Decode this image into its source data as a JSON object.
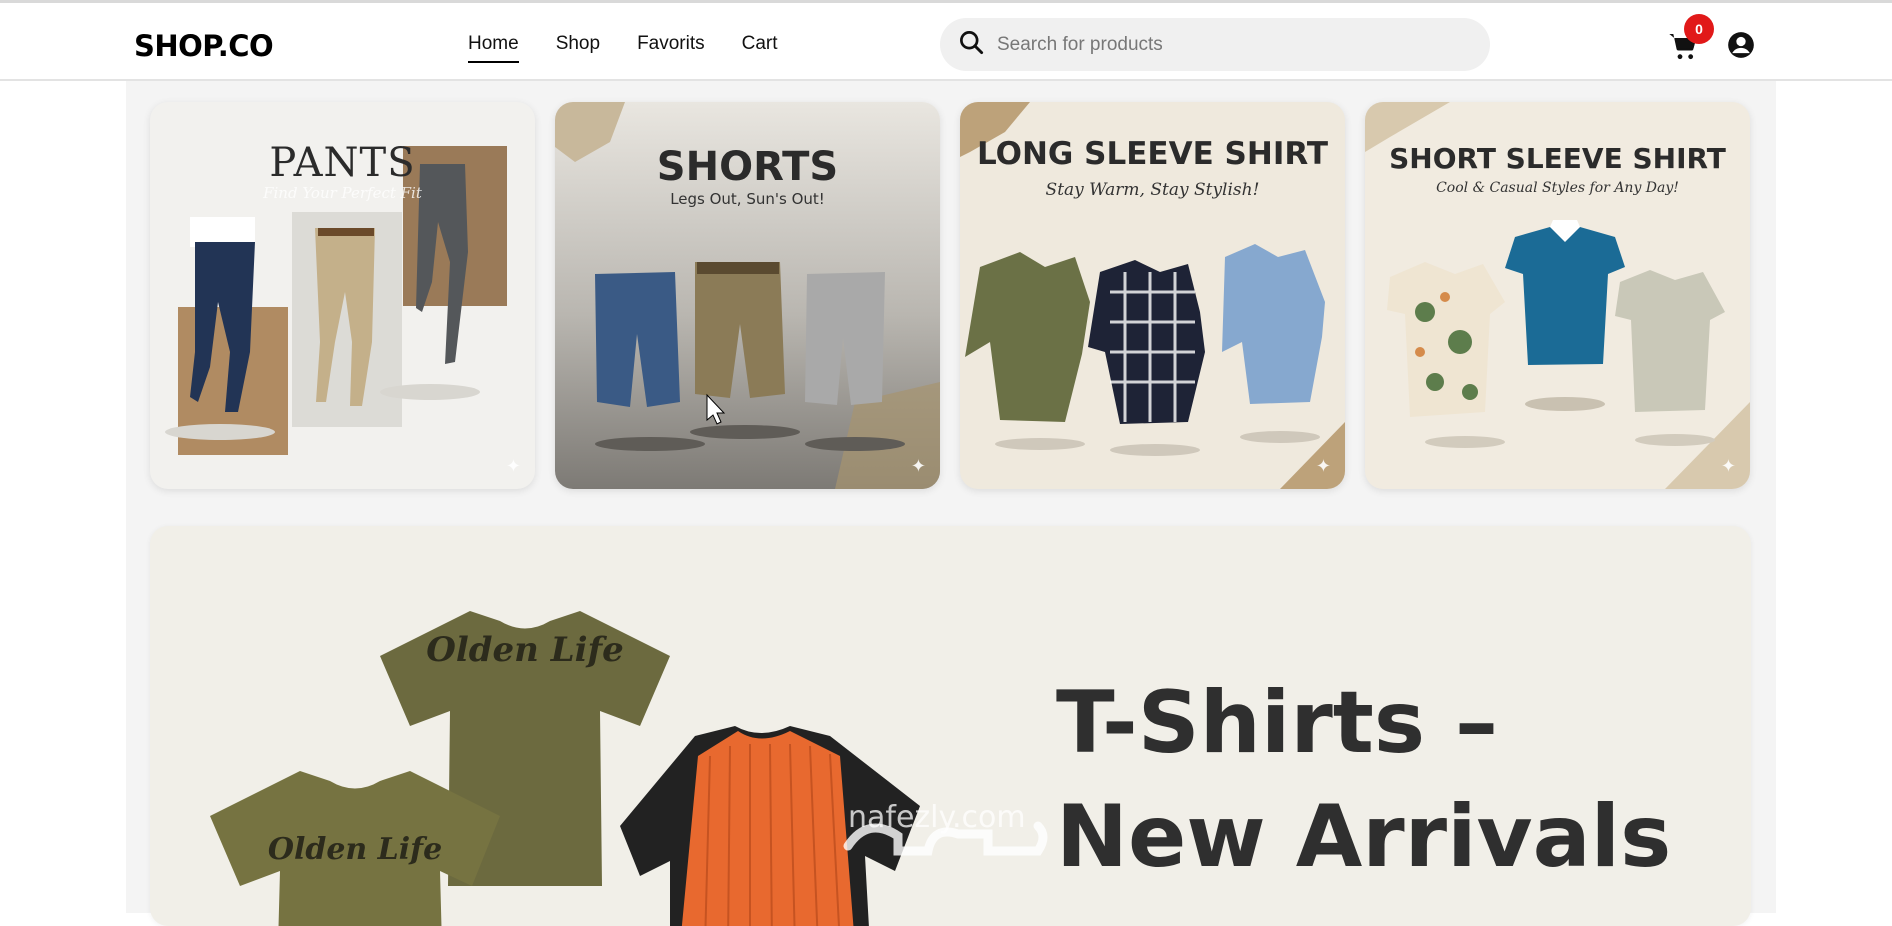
{
  "header": {
    "logo": "SHOP.CO",
    "nav": [
      {
        "label": "Home",
        "active": true
      },
      {
        "label": "Shop",
        "active": false
      },
      {
        "label": "Favorits",
        "active": false
      },
      {
        "label": "Cart",
        "active": false
      }
    ],
    "search": {
      "placeholder": "Search for products",
      "value": ""
    },
    "cart_count": "0",
    "icons": [
      "search-icon",
      "cart-icon",
      "user-icon"
    ]
  },
  "categories": [
    {
      "title": "PANTS",
      "subtitle": "Find Your Perfect Fit"
    },
    {
      "title": "SHORTS",
      "subtitle": "Legs Out, Sun's Out!"
    },
    {
      "title": "LONG SLEEVE SHIRT",
      "subtitle": "Stay Warm, Stay Stylish!"
    },
    {
      "title": "SHORT SLEEVE SHIRT",
      "subtitle": "Cool & Casual Styles for Any Day!"
    }
  ],
  "banner": {
    "title_line1": "T-Shirts –",
    "title_line2": "New Arrivals",
    "shirt_print": "Olden Life"
  },
  "watermark": {
    "text": "nafezly.com"
  },
  "colors": {
    "badge": "#e11919",
    "accent": "#000000",
    "page_bg": "#f4f4f4"
  }
}
